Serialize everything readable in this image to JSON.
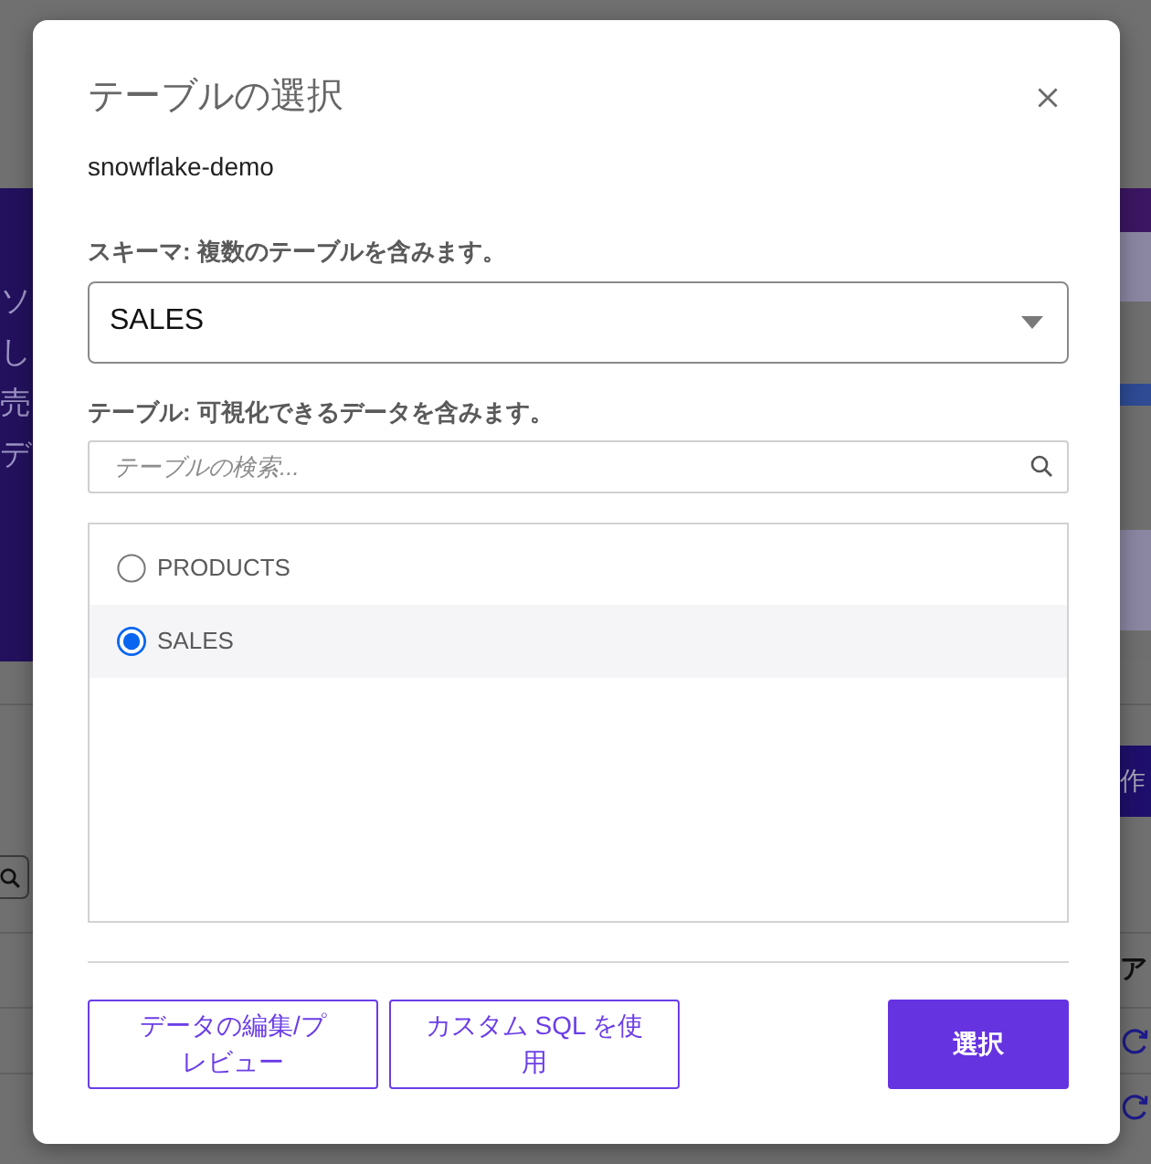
{
  "background": {
    "banner_text": [
      "ソ",
      "し",
      "売",
      "デ"
    ],
    "button": {
      "label": "作"
    },
    "label": "ア"
  },
  "dialog": {
    "title": "テーブルの選択",
    "connection": "snowflake-demo",
    "schema_label": "スキーマ: 複数のテーブルを含みます。",
    "schema_select": {
      "value": "SALES"
    },
    "table_label": "テーブル: 可視化できるデータを含みます。",
    "table_search": {
      "placeholder": "テーブルの検索..."
    },
    "tables": [
      {
        "label": "PRODUCTS",
        "selected": false
      },
      {
        "label": "SALES",
        "selected": true
      }
    ],
    "buttons": [
      {
        "label": "データの編集/プレビュー",
        "kind": "outline"
      },
      {
        "label": "カスタム SQL を使用",
        "kind": "outline"
      },
      {
        "label": "選択",
        "kind": "primary"
      }
    ]
  }
}
